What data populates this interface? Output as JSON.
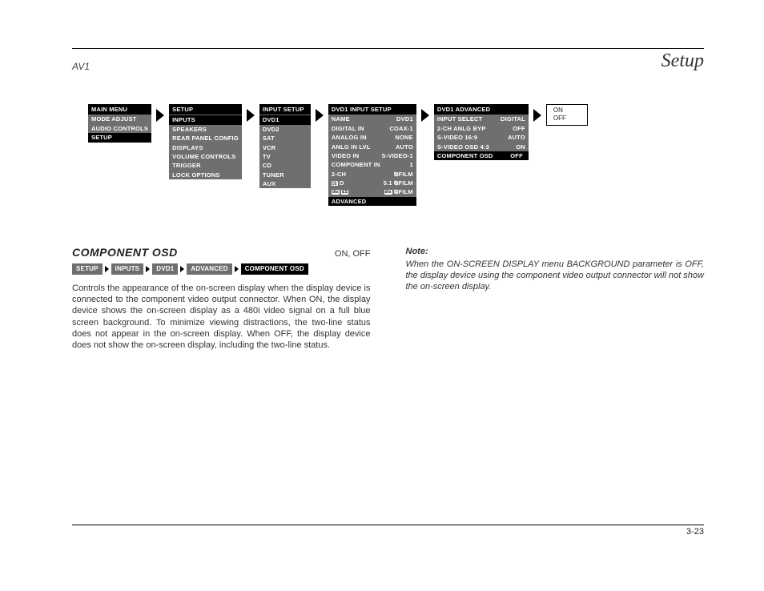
{
  "header": {
    "left": "AV1",
    "right": "Setup"
  },
  "nav": {
    "box1": {
      "title": "MAIN MENU",
      "items": [
        "MODE ADJUST",
        "AUDIO CONTROLS",
        "SETUP"
      ],
      "highlight": 2
    },
    "box2": {
      "title": "SETUP",
      "items": [
        "INPUTS",
        "SPEAKERS",
        "REAR PANEL CONFIG",
        "DISPLAYS",
        "VOLUME CONTROLS",
        "TRIGGER",
        "LOCK OPTIONS"
      ],
      "highlight": 0
    },
    "box3": {
      "title": "INPUT SETUP",
      "items": [
        "DVD1",
        "DVD2",
        "SAT",
        "VCR",
        "TV",
        "CD",
        "TUNER",
        "AUX"
      ],
      "highlight": 0
    },
    "box4": {
      "title": "DVD1 INPUT SETUP",
      "rows": [
        {
          "l": "NAME",
          "r": "DVD1"
        },
        {
          "l": "DIGITAL IN",
          "r": "COAX-1"
        },
        {
          "l": "ANALOG IN",
          "r": "NONE"
        },
        {
          "l": "ANLG IN LVL",
          "r": "AUTO"
        },
        {
          "l": "VIDEO IN",
          "r": "S-VIDEO-1"
        },
        {
          "l": "COMPONENT IN",
          "r": "1"
        },
        {
          "l": "2-CH",
          "r": "⧉FILM"
        },
        {
          "l": "▢▢D",
          "r": "5.1 ⧉FILM"
        },
        {
          "l": "dts",
          "r": "⧉FILM"
        },
        {
          "l": "ADVANCED",
          "r": ""
        }
      ],
      "highlight": 9
    },
    "box5": {
      "title": "DVD1 ADVANCED",
      "rows": [
        {
          "l": "INPUT SELECT",
          "r": "DIGITAL"
        },
        {
          "l": "2-CH ANLG BYP",
          "r": "OFF"
        },
        {
          "l": "S-VIDEO 16:9",
          "r": "AUTO"
        },
        {
          "l": "S-VIDEO OSD 4:3",
          "r": "ON"
        },
        {
          "l": "COMPONENT OSD",
          "r": "OFF"
        }
      ],
      "highlight": 4
    },
    "onoff": "ON\nOFF"
  },
  "section": {
    "title": "COMPONENT OSD",
    "options": "ON, OFF",
    "crumbs": [
      "SETUP",
      "INPUTS",
      "DVD1",
      "ADVANCED",
      "COMPONENT OSD"
    ],
    "body": "Controls the appearance of the on-screen display when the display device is connected to the component video output connector. When ON, the display device shows the on-screen display as a 480i video signal on a full blue screen background. To minimize viewing distractions, the two-line status does not appear in the on-screen display. When OFF, the display device does not show the on-screen display, including the two-line status."
  },
  "note": {
    "head": "Note:",
    "body": "When the ON-SCREEN DISPLAY menu BACKGROUND parameter is OFF, the display device using the component video output connector will not show the on-screen display."
  },
  "footer": "3-23"
}
